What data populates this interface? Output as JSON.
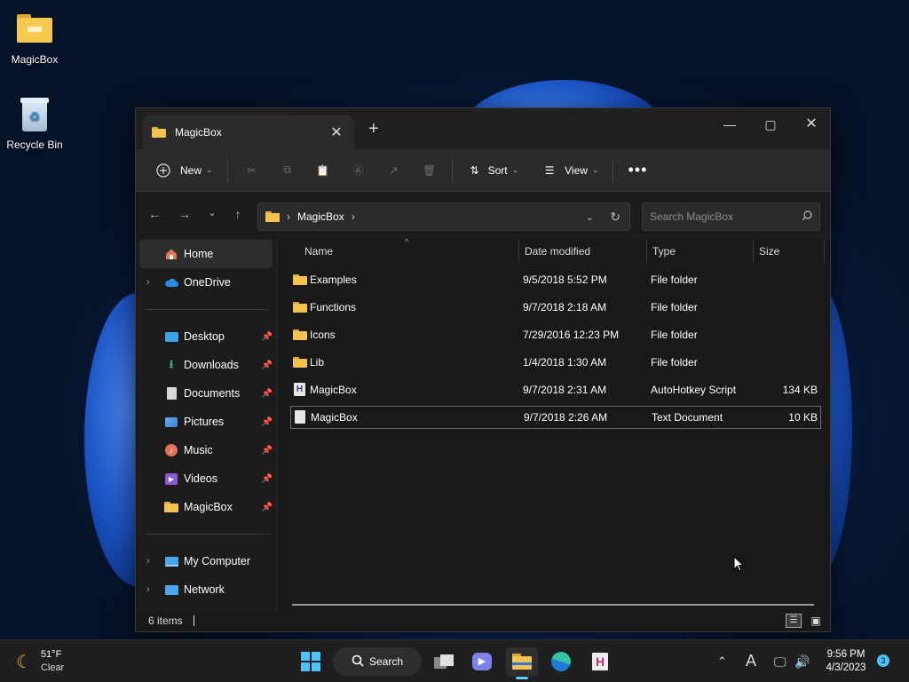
{
  "desktop": {
    "icons": [
      {
        "label": "MagicBox"
      },
      {
        "label": "Recycle Bin"
      }
    ]
  },
  "window": {
    "tab_title": "MagicBox",
    "toolbar": {
      "new_label": "New",
      "sort_label": "Sort",
      "view_label": "View"
    },
    "address": {
      "crumb": "MagicBox",
      "search_placeholder": "Search MagicBox"
    },
    "sidebar": {
      "items": [
        {
          "label": "Home"
        },
        {
          "label": "OneDrive"
        },
        {
          "label": "Desktop"
        },
        {
          "label": "Downloads"
        },
        {
          "label": "Documents"
        },
        {
          "label": "Pictures"
        },
        {
          "label": "Music"
        },
        {
          "label": "Videos"
        },
        {
          "label": "MagicBox"
        },
        {
          "label": "My Computer"
        },
        {
          "label": "Network"
        }
      ]
    },
    "columns": {
      "name": "Name",
      "date": "Date modified",
      "type": "Type",
      "size": "Size"
    },
    "files": [
      {
        "name": "Examples",
        "date": "9/5/2018 5:52 PM",
        "type": "File folder",
        "size": ""
      },
      {
        "name": "Functions",
        "date": "9/7/2018 2:18 AM",
        "type": "File folder",
        "size": ""
      },
      {
        "name": "Icons",
        "date": "7/29/2016 12:23 PM",
        "type": "File folder",
        "size": ""
      },
      {
        "name": "Lib",
        "date": "1/4/2018 1:30 AM",
        "type": "File folder",
        "size": ""
      },
      {
        "name": "MagicBox",
        "date": "9/7/2018 2:31 AM",
        "type": "AutoHotkey Script",
        "size": "134 KB"
      },
      {
        "name": "MagicBox",
        "date": "9/7/2018 2:26 AM",
        "type": "Text Document",
        "size": "10 KB"
      }
    ],
    "status": "6 items"
  },
  "taskbar": {
    "weather_temp": "51°F",
    "weather_desc": "Clear",
    "search_label": "Search",
    "time": "9:56 PM",
    "date": "4/3/2023",
    "notification_count": "3"
  }
}
